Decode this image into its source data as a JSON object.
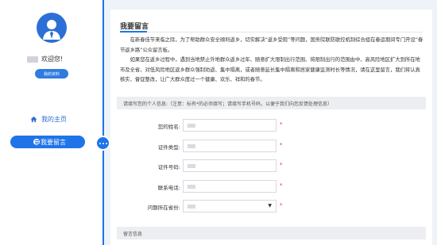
{
  "sidebar": {
    "welcome": "欢迎您!",
    "profile_button": "我的资料",
    "nav": [
      {
        "label": "我的主页",
        "icon": "home-icon"
      },
      {
        "label": "我要留言",
        "icon": "message-icon",
        "active": true
      }
    ]
  },
  "main": {
    "title": "我要留言",
    "intro": [
      "在新春佳节来临之际，为了帮助群众安全顺利返乡，切实解决“返乡受阻”等问题，国务院联防联控机制综合组在春运期间专门开设“春节返乡路”公众留言板。",
      "如果您在返乡过程中，遇到当地禁止外地群众返乡过年、随意扩大限制出行范围、将限制出行的范围由中、高风险地区扩大到所在地市及全省、对低风险地区返乡群众强制劝返、集中隔离，或者随意延长集中隔离和居家健康监测时长等情况，请在这里留言，我们将认真核实、督促整改，让广大群众度过一个健康、欢乐、祥和的春节。"
    ],
    "personal_section": "请填写您的个人信息:（注意：标有*的必须填写；请填写手机号码，以便于我们向您反馈处理信息）",
    "fields": [
      {
        "label": "您的姓名:",
        "required": "*"
      },
      {
        "label": "证件类型:",
        "required": "*"
      },
      {
        "label": "证件号码:",
        "required": "*"
      },
      {
        "label": "联系电话:",
        "required": "*"
      },
      {
        "label": "问题所在省份:",
        "required": "*",
        "select": true
      }
    ],
    "message_section": "留言信息"
  },
  "colors": {
    "accent": "#1f74e8",
    "required": "#ee3333"
  }
}
